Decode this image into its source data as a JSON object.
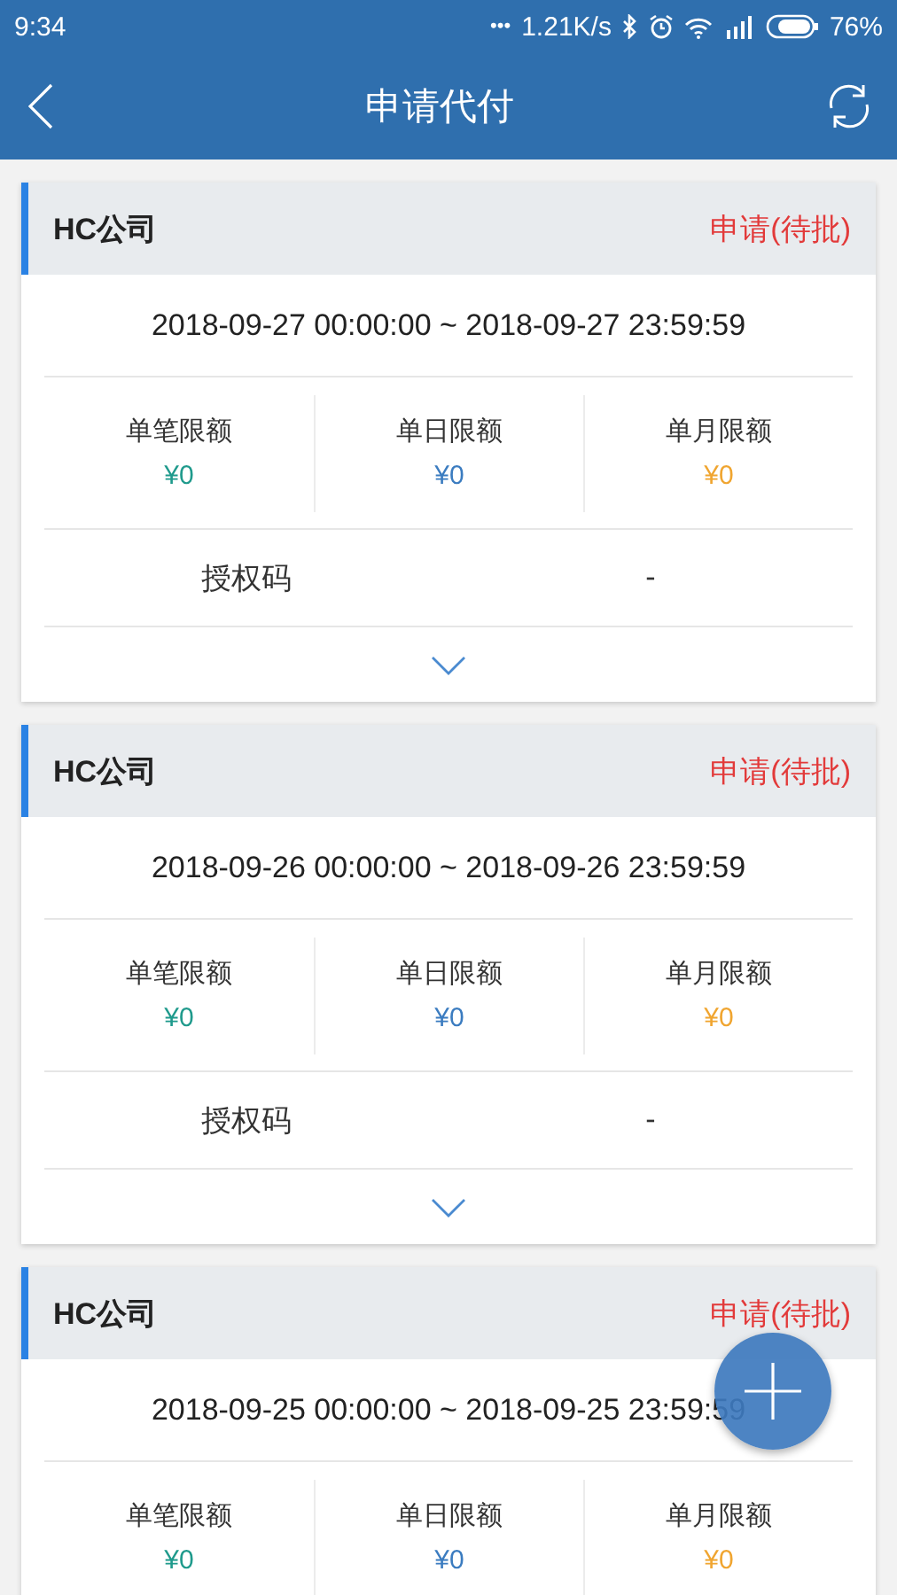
{
  "status_bar": {
    "time": "9:34",
    "more": "•••",
    "speed": "1.21K/s",
    "battery": "76%"
  },
  "header": {
    "title": "申请代付"
  },
  "cards": [
    {
      "company": "HC公司",
      "status": "申请(待批)",
      "period": "2018-09-27 00:00:00 ~ 2018-09-27 23:59:59",
      "limits": [
        {
          "label": "单笔限额",
          "value": "¥0",
          "color": "#1f9a8c"
        },
        {
          "label": "单日限额",
          "value": "¥0",
          "color": "#3b7cc0"
        },
        {
          "label": "单月限额",
          "value": "¥0",
          "color": "#f0a530"
        }
      ],
      "auth_label": "授权码",
      "auth_value": "-"
    },
    {
      "company": "HC公司",
      "status": "申请(待批)",
      "period": "2018-09-26 00:00:00 ~ 2018-09-26 23:59:59",
      "limits": [
        {
          "label": "单笔限额",
          "value": "¥0",
          "color": "#1f9a8c"
        },
        {
          "label": "单日限额",
          "value": "¥0",
          "color": "#3b7cc0"
        },
        {
          "label": "单月限额",
          "value": "¥0",
          "color": "#f0a530"
        }
      ],
      "auth_label": "授权码",
      "auth_value": "-"
    },
    {
      "company": "HC公司",
      "status": "申请(待批)",
      "period": "2018-09-25 00:00:00 ~ 2018-09-25 23:59:59",
      "limits": [
        {
          "label": "单笔限额",
          "value": "¥0",
          "color": "#1f9a8c"
        },
        {
          "label": "单日限额",
          "value": "¥0",
          "color": "#3b7cc0"
        },
        {
          "label": "单月限额",
          "value": "¥0",
          "color": "#f0a530"
        }
      ]
    }
  ]
}
